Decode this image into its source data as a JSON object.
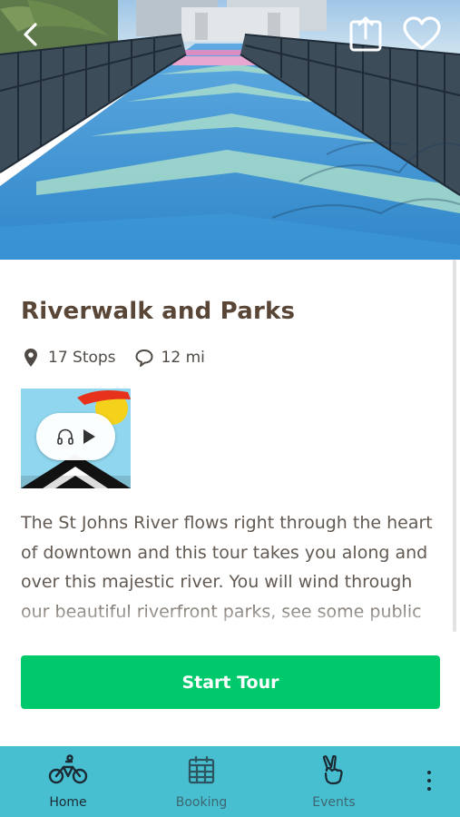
{
  "header": {
    "back_icon": "chevron-left-icon",
    "share_icon": "share-icon",
    "favorite_icon": "heart-icon"
  },
  "tour": {
    "title": "Riverwalk and Parks",
    "stops": "17 Stops",
    "distance": "12 mi",
    "stops_icon": "map-pin-icon",
    "distance_icon": "route-loop-icon",
    "audio_icons": [
      "headphones-icon",
      "play-icon"
    ],
    "description": "The St Johns River flows right through the heart of downtown and this tour takes you along and over this majestic river. You will wind through our beautiful riverfront parks, see some public",
    "start_label": "Start Tour"
  },
  "nav": {
    "items": [
      {
        "label": "Home",
        "icon": "bicycle-icon",
        "active": true
      },
      {
        "label": "Booking",
        "icon": "calendar-icon",
        "active": false
      },
      {
        "label": "Events",
        "icon": "peace-hand-icon",
        "active": false
      }
    ],
    "more_icon": "more-vertical-icon"
  },
  "colors": {
    "title": "#5a4636",
    "body_text": "#625a52",
    "primary_button": "#00c96b",
    "nav_background": "#48bfd1",
    "nav_active": "#1b2a33",
    "nav_inactive": "#3c6670"
  }
}
